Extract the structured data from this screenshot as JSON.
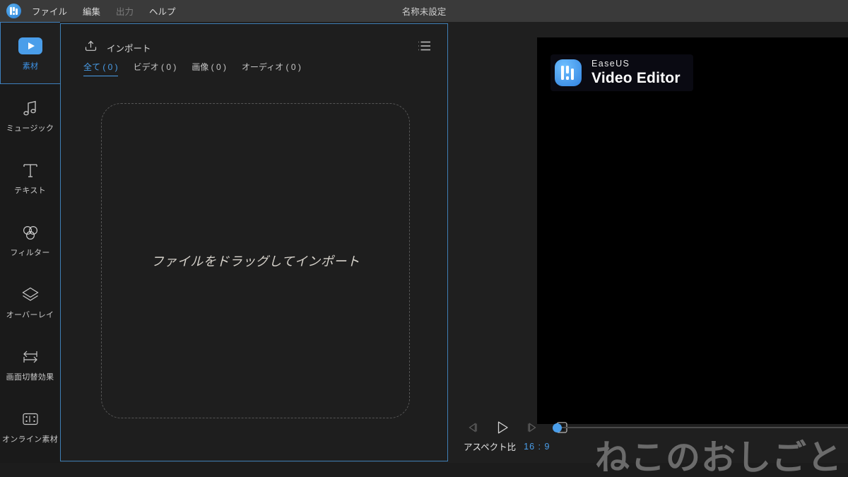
{
  "titlebar": {
    "app_logo": "easeus-logo-icon",
    "window_title": "名称未設定",
    "menus": [
      {
        "label": "ファイル",
        "disabled": false
      },
      {
        "label": "編集",
        "disabled": false
      },
      {
        "label": "出力",
        "disabled": true
      },
      {
        "label": "ヘルプ",
        "disabled": false
      }
    ]
  },
  "sidebar": {
    "items": [
      {
        "label": "素材",
        "icon": "play-button-icon",
        "active": true
      },
      {
        "label": "ミュージック",
        "icon": "music-note-icon",
        "active": false
      },
      {
        "label": "テキスト",
        "icon": "text-t-icon",
        "active": false
      },
      {
        "label": "フィルター",
        "icon": "venn-circles-icon",
        "active": false
      },
      {
        "label": "オーバーレイ",
        "icon": "stacked-diamond-icon",
        "active": false
      },
      {
        "label": "画面切替効果",
        "icon": "transition-arrows-icon",
        "active": false
      },
      {
        "label": "オンライン素材",
        "icon": "film-strip-icon",
        "active": false
      }
    ]
  },
  "media_panel": {
    "import_label": "インポート",
    "import_icon": "import-upload-icon",
    "listview_icon": "list-view-icon",
    "tabs": [
      {
        "label": "全て ( 0 )",
        "active": true
      },
      {
        "label": "ビデオ ( 0 )",
        "active": false
      },
      {
        "label": "画像 ( 0 )",
        "active": false
      },
      {
        "label": "オーディオ ( 0 )",
        "active": false
      }
    ],
    "dropzone_text": "ファイルをドラッグしてインポート"
  },
  "preview_panel": {
    "brand_sub": "EaseUS",
    "brand_main": "Video Editor",
    "brand_icon": "easeus-brand-icon",
    "transport": [
      {
        "name": "previous-frame-button",
        "icon": "step-backward-icon",
        "disabled": true
      },
      {
        "name": "play-button",
        "icon": "play-triangle-icon",
        "disabled": false
      },
      {
        "name": "next-frame-button",
        "icon": "step-forward-icon",
        "disabled": true
      },
      {
        "name": "stop-button",
        "icon": "stop-square-icon",
        "disabled": false
      }
    ],
    "volume_value": 0,
    "aspect_label": "アスペクト比",
    "aspect_value": "16 : 9"
  },
  "watermark": {
    "text": "ねこのおしごと"
  },
  "colors": {
    "accent": "#4a9eea",
    "panel_border": "#3f7fb5",
    "background": "#1f1f1f",
    "titlebar": "#3a3a3a",
    "rail": "#1a1a1a",
    "video_black": "#000000",
    "watermark_gray": "#6b6b6b"
  }
}
